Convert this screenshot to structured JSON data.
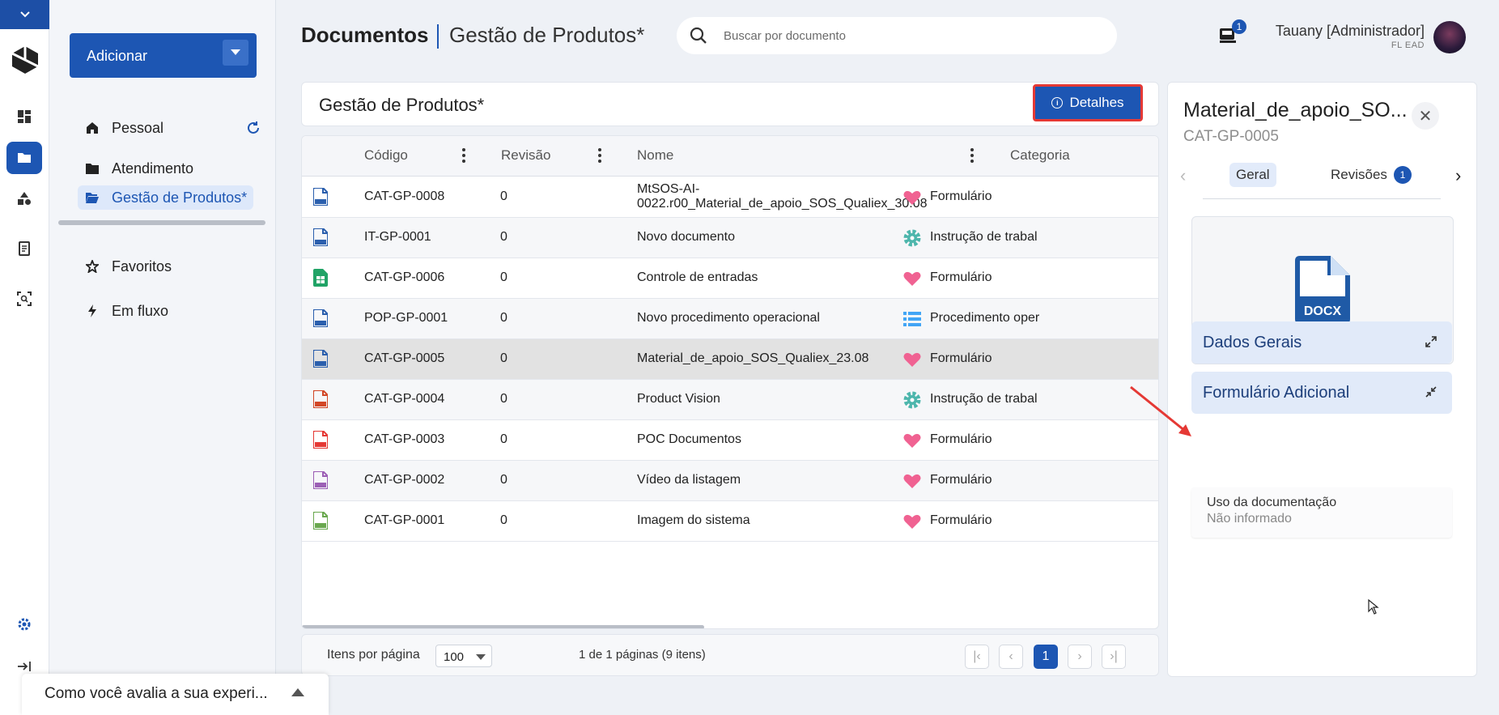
{
  "rail": {
    "icons": [
      "chevron-down-icon",
      "app-logo",
      "dashboard-icon",
      "folder-open-icon",
      "shapes-icon",
      "document-list-icon",
      "scan-search-icon",
      "settings-icon",
      "collapse-icon"
    ]
  },
  "sidebar": {
    "add_button": "Adicionar",
    "items": [
      {
        "label": "Pessoal",
        "icon": "home-icon"
      },
      {
        "label": "Atendimento",
        "icon": "folder-icon"
      },
      {
        "label": "Gestão de Produtos*",
        "icon": "folder-open-icon"
      },
      {
        "label": "Favoritos",
        "icon": "star-icon"
      },
      {
        "label": "Em fluxo",
        "icon": "bolt-icon"
      }
    ]
  },
  "header": {
    "title": "Documentos",
    "subtitle": "Gestão de Produtos*",
    "search_placeholder": "Buscar por documento",
    "notification_count": "1",
    "user_name": "Tauany [Administrador]",
    "user_org": "FL EAD"
  },
  "main": {
    "panel_title": "Gestão de Produtos*",
    "details_button": "Detalhes",
    "columns": [
      "Código",
      "Revisão",
      "Nome",
      "Categoria"
    ],
    "rows": [
      {
        "type": "docx",
        "code": "CAT-GP-0008",
        "rev": "0",
        "name1": "MtSOS-AI-",
        "name2": "0022.r00_Material_de_apoio_SOS_Qualiex_30.08",
        "cat_icon": "heart",
        "category": "Formulário"
      },
      {
        "type": "docx",
        "code": "IT-GP-0001",
        "rev": "0",
        "name1": "Novo documento",
        "name2": "",
        "cat_icon": "gear",
        "category": "Instrução de trabal"
      },
      {
        "type": "xlsx",
        "code": "CAT-GP-0006",
        "rev": "0",
        "name1": "Controle de entradas",
        "name2": "",
        "cat_icon": "heart",
        "category": "Formulário"
      },
      {
        "type": "docx",
        "code": "POP-GP-0001",
        "rev": "0",
        "name1": "Novo procedimento operacional",
        "name2": "",
        "cat_icon": "list",
        "category": "Procedimento oper"
      },
      {
        "type": "docx",
        "code": "CAT-GP-0005",
        "rev": "0",
        "name1": "Material_de_apoio_SOS_Qualiex_23.08",
        "name2": "",
        "cat_icon": "heart",
        "category": "Formulário"
      },
      {
        "type": "pptx",
        "code": "CAT-GP-0004",
        "rev": "0",
        "name1": "Product Vision",
        "name2": "",
        "cat_icon": "gear",
        "category": "Instrução de trabal"
      },
      {
        "type": "pdf",
        "code": "CAT-GP-0003",
        "rev": "0",
        "name1": "POC Documentos",
        "name2": "",
        "cat_icon": "heart",
        "category": "Formulário"
      },
      {
        "type": "gif",
        "code": "CAT-GP-0002",
        "rev": "0",
        "name1": "Vídeo da listagem",
        "name2": "",
        "cat_icon": "heart",
        "category": "Formulário"
      },
      {
        "type": "png",
        "code": "CAT-GP-0001",
        "rev": "0",
        "name1": "Imagem do sistema",
        "name2": "",
        "cat_icon": "heart",
        "category": "Formulário"
      }
    ],
    "file_colors": {
      "docx": "#2b5fad",
      "xlsx": "#21a366",
      "pptx": "#d24726",
      "pdf": "#e53935",
      "gif": "#9c5fb5",
      "png": "#6aa84f"
    },
    "pager": {
      "label": "Itens por página",
      "per_page": "100",
      "info": "1 de 1 páginas (9 itens)",
      "first": "|‹",
      "prev": "‹",
      "current": "1",
      "next": "›",
      "last": "›|"
    }
  },
  "details": {
    "title": "Material_de_apoio_SO...",
    "code": "CAT-GP-0005",
    "tabs": [
      {
        "label": "Geral"
      },
      {
        "label": "Revisões",
        "badge": "1"
      }
    ],
    "preview_label": "DOCX",
    "sections": [
      {
        "title": "Dados Gerais",
        "icon": "expand-icon"
      },
      {
        "title": "Formulário Adicional",
        "icon": "collapse-icon"
      }
    ],
    "field_label": "Uso da documentação",
    "field_value": "Não informado"
  },
  "feedback": {
    "text": "Como você avalia a sua experi..."
  },
  "colors": {
    "primary": "#1d56b3",
    "highlight_border": "#e53935",
    "heart": "#f06292",
    "gear": "#4db6ac",
    "list": "#42a5f5"
  }
}
